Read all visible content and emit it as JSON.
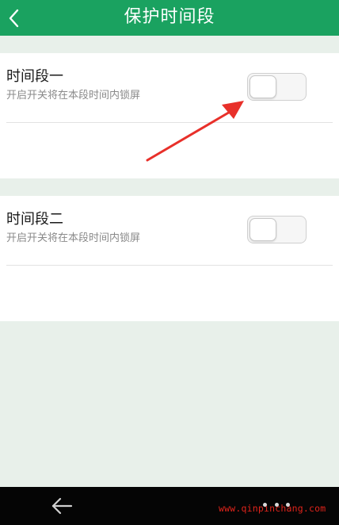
{
  "header": {
    "title": "保护时间段",
    "background_color": "#1aa260",
    "back_icon": "chevron-left-icon"
  },
  "sections": [
    {
      "title": "时间段一",
      "description": "开启开关将在本段时间内锁屏",
      "toggle_on": false
    },
    {
      "title": "时间段二",
      "description": "开启开关将在本段时间内锁屏",
      "toggle_on": false
    }
  ],
  "annotation": {
    "color": "#e8302a",
    "icon": "red-pointer-arrow"
  },
  "navbar": {
    "back_icon": "arrow-left-icon",
    "menu_icon": "three-dots-icon",
    "watermark": "www.qinpinchang.com"
  }
}
